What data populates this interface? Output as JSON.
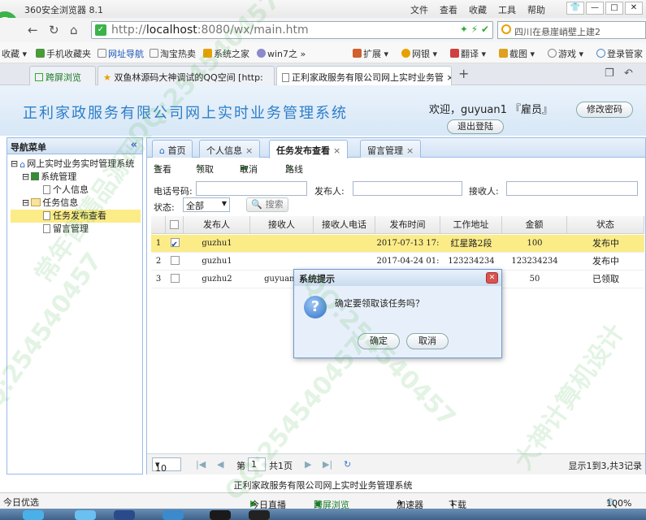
{
  "browser": {
    "title": "360安全浏览器 8.1",
    "menus": [
      "文件",
      "查看",
      "收藏",
      "工具",
      "帮助"
    ],
    "url_prefix": "http://",
    "url_host": "localhost",
    "url_rest": ":8080/wx/main.htm",
    "search_text": "四川在悬崖峭壁上建2",
    "bookmarks": [
      "收藏",
      "手机收藏夹",
      "网址导航",
      "淘宝热卖",
      "系统之家",
      "win7之"
    ],
    "bookmarks_right": [
      "扩展",
      "网银",
      "翻译",
      "截图",
      "游戏",
      "登录管家"
    ],
    "tabs": [
      "跨屏浏览",
      "双鱼林源码大神调试的QQ空间 [http:",
      "正利家政服务有限公司网上实时业务管"
    ],
    "tab_close": "×",
    "new_tab": "+"
  },
  "app": {
    "title": "正利家政服务有限公司网上实时业务管理系统",
    "welcome": "欢迎，guyuan1 『雇员』",
    "change_pwd": "修改密码",
    "logout": "退出登陆",
    "footer": "正利家政服务有限公司网上实时业务管理系统"
  },
  "nav": {
    "title": "导航菜单",
    "collapse": "«",
    "root": "网上实时业务实时管理系统",
    "groups": [
      {
        "label": "系统管理",
        "items": [
          "个人信息"
        ]
      },
      {
        "label": "任务信息",
        "items": [
          "任务发布查看",
          "留言管理"
        ]
      }
    ]
  },
  "main": {
    "tabs": [
      {
        "label": "首页"
      },
      {
        "label": "个人信息",
        "close": "×"
      },
      {
        "label": "任务发布查看",
        "close": "×"
      },
      {
        "label": "留言管理",
        "close": "×"
      }
    ],
    "toolbar": [
      "查看",
      "领取",
      "取消",
      "路线"
    ],
    "filters": {
      "phone_label": "电话号码:",
      "publisher_label": "发布人:",
      "receiver_label": "接收人:",
      "status_label": "状态:",
      "status_value": "全部",
      "search_button": "搜索"
    },
    "columns": [
      "",
      "",
      "发布人",
      "接收人",
      "接收人电话",
      "发布时间",
      "工作地址",
      "金额",
      "状态"
    ],
    "rows": [
      {
        "no": "1",
        "checked": true,
        "publisher": "guzhu1",
        "receiver": "",
        "phone": "",
        "time": "2017-07-13 17:",
        "address": "红星路2段",
        "amount": "100",
        "status": "发布中"
      },
      {
        "no": "2",
        "checked": false,
        "publisher": "guzhu1",
        "receiver": "",
        "phone": "",
        "time": "2017-04-24 01:",
        "address": "123234234",
        "amount": "123234234",
        "status": "发布中"
      },
      {
        "no": "3",
        "checked": false,
        "publisher": "guzhu2",
        "receiver": "guyuan1",
        "phone": "",
        "time": "",
        "address": "",
        "amount": "50",
        "status": "已领取"
      }
    ],
    "pager": {
      "page_size": "10",
      "page_label": "第",
      "page": "1",
      "total_pages": "共1页",
      "summary": "显示1到3,共3记录"
    }
  },
  "dialog": {
    "title": "系统提示",
    "message": "确定要领取该任务吗？",
    "ok": "确定",
    "cancel": "取消"
  },
  "statusbar": {
    "left": "今日优选",
    "items": [
      "今日直播",
      "跨屏浏览",
      "加速器",
      "下载"
    ],
    "zoom": "100%"
  },
  "watermarks": [
    "常年售精品源码",
    "QQ:254540457",
    "大神计算机设计"
  ]
}
